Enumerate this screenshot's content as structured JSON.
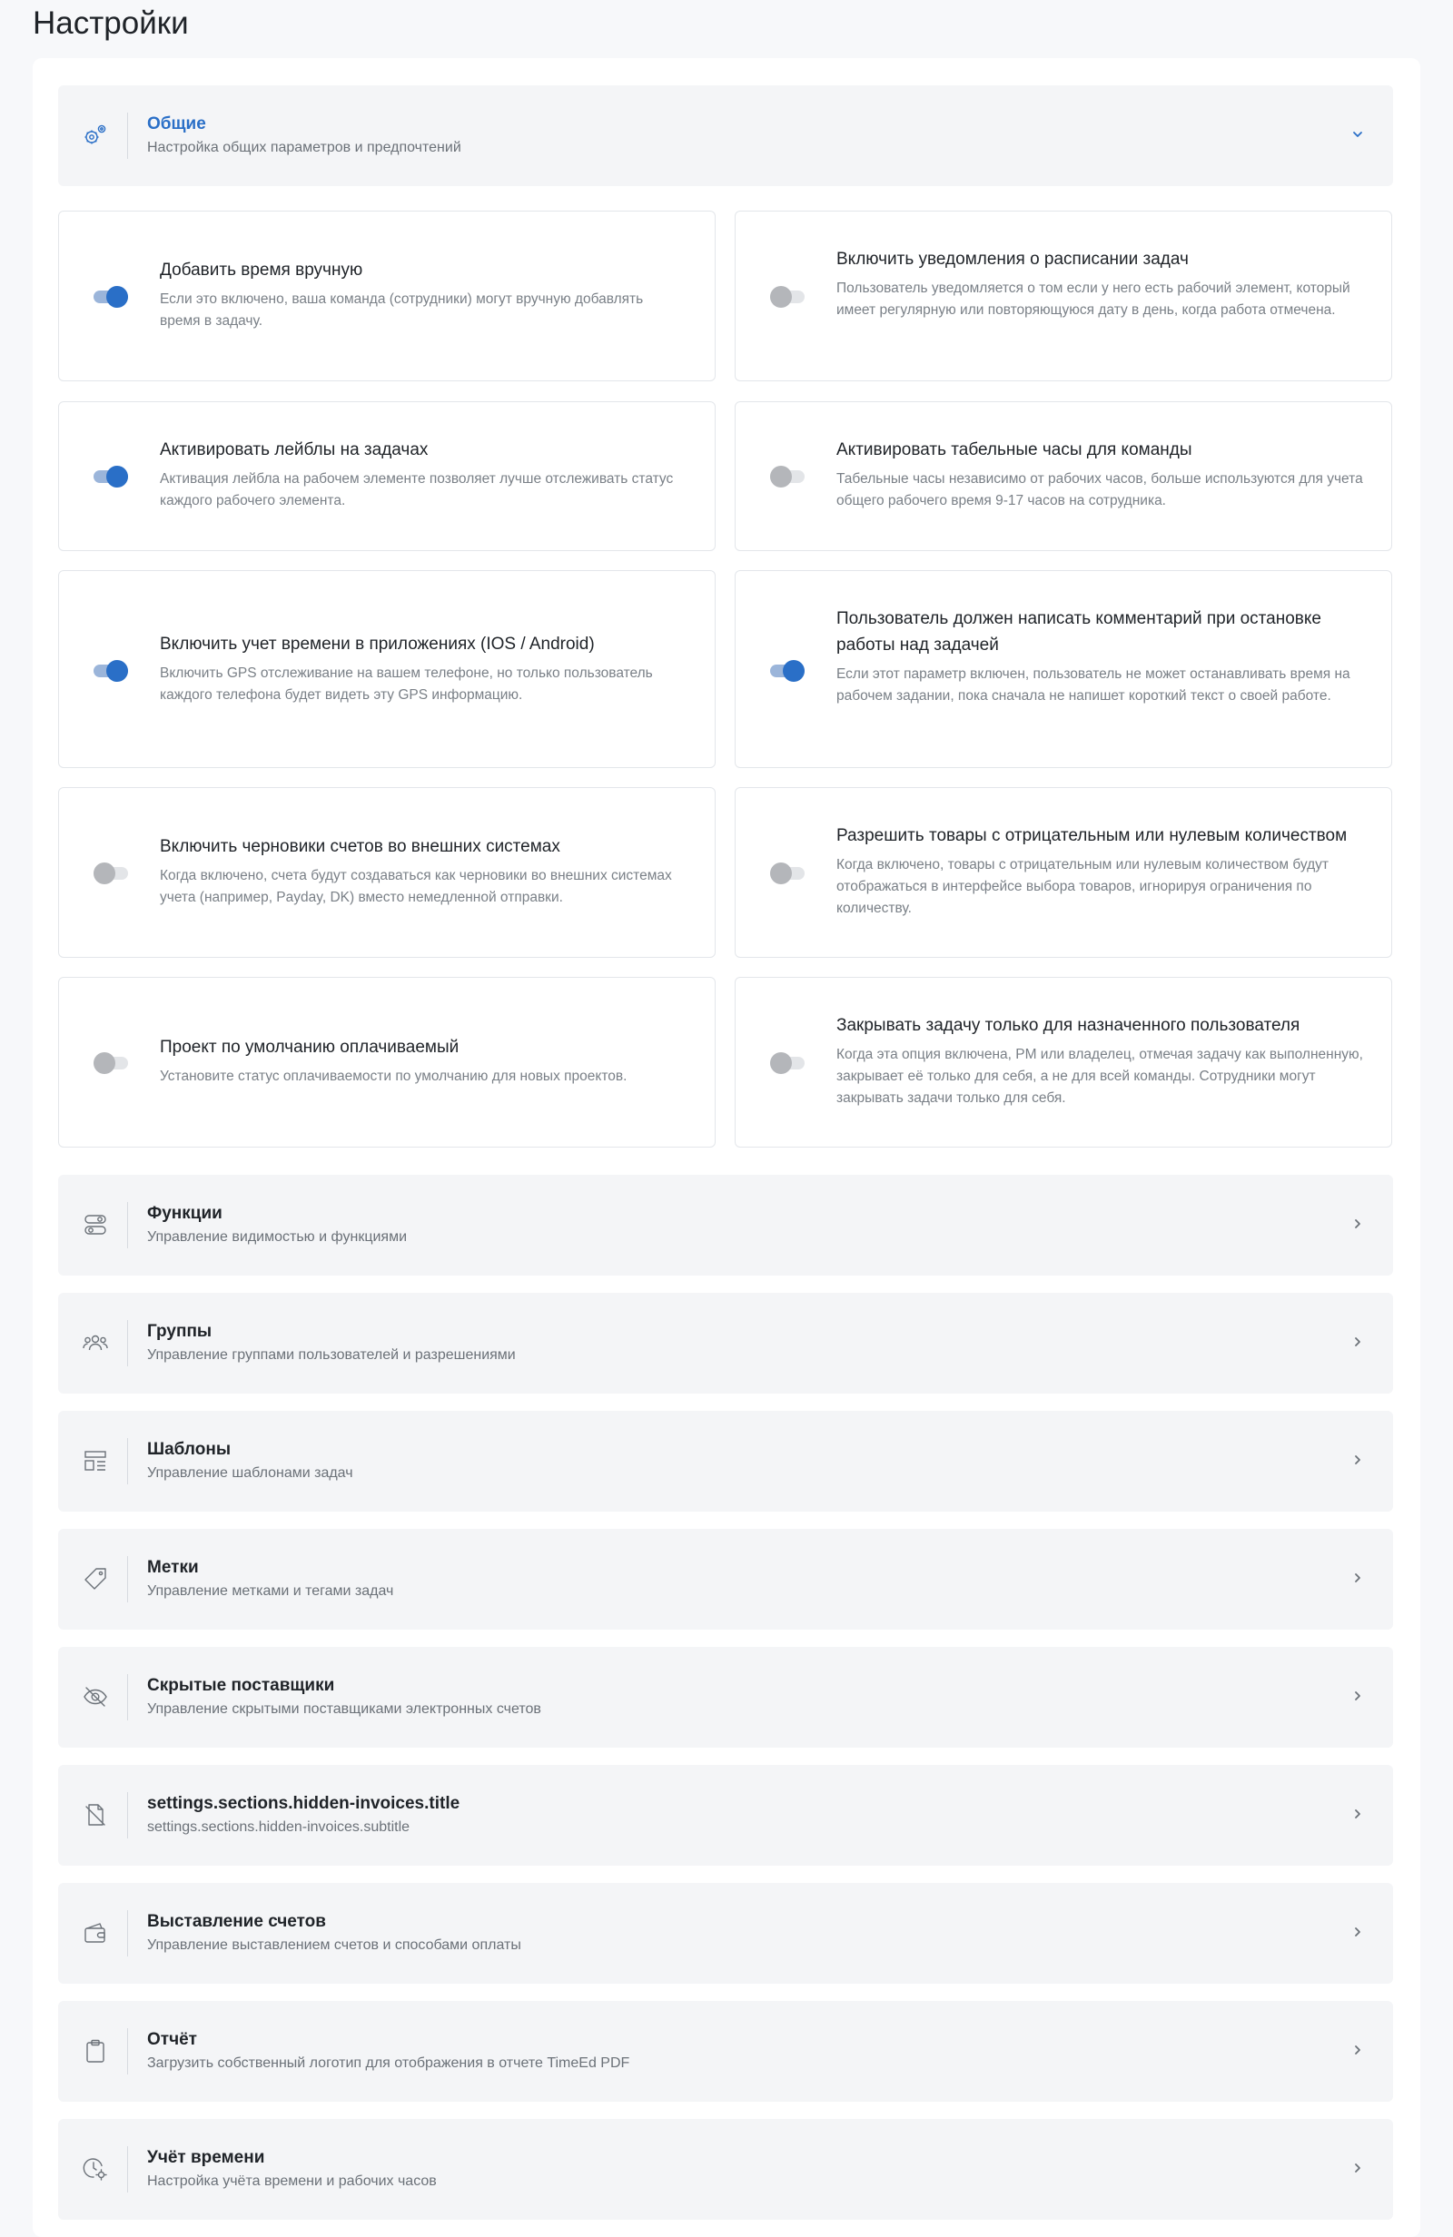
{
  "page": {
    "title": "Настройки"
  },
  "general": {
    "title": "Общие",
    "subtitle": "Настройка общих параметров и предпочтений",
    "icon": "gears-icon",
    "expanded": true
  },
  "settings": [
    {
      "title": "Добавить время вручную",
      "description": "Если это включено, ваша команда (сотрудники) могут вручную добавлять время в задачу.",
      "enabled": true
    },
    {
      "title": "Включить уведомления о расписании задач",
      "description": "Пользователь уведомляется о том если у него есть рабочий элемент, который имеет регулярную или повторяющуюся дату в день, когда работа отмечена.",
      "enabled": false
    },
    {
      "title": "Активировать лейблы на задачах",
      "description": "Активация лейбла на рабочем элементе позволяет лучше отслеживать статус каждого рабочего элемента.",
      "enabled": true
    },
    {
      "title": "Активировать табельные часы для команды",
      "description": "Табельные часы независимо от рабочих часов, больше используются для учета общего рабочего время 9-17 часов на сотрудника.",
      "enabled": false
    },
    {
      "title": "Включить учет времени в приложениях (IOS / Android)",
      "description": "Включить GPS отслеживание на вашем телефоне, но только пользователь каждого телефона будет видеть эту GPS информацию.",
      "enabled": true
    },
    {
      "title": "Пользователь должен написать комментарий при остановке работы над задачей",
      "description": "Если этот параметр включен, пользователь не может останавливать время на рабочем задании, пока сначала не напишет короткий текст о своей работе.",
      "enabled": true
    },
    {
      "title": "Включить черновики счетов во внешних системах",
      "description": "Когда включено, счета будут создаваться как черновики во внешних системах учета (например, Payday, DK) вместо немедленной отправки.",
      "enabled": false
    },
    {
      "title": "Разрешить товары с отрицательным или нулевым количеством",
      "description": "Когда включено, товары с отрицательным или нулевым количеством будут отображаться в интерфейсе выбора товаров, игнорируя ограничения по количеству.",
      "enabled": false
    },
    {
      "title": "Проект по умолчанию оплачиваемый",
      "description": "Установите статус оплачиваемости по умолчанию для новых проектов.",
      "enabled": false
    },
    {
      "title": "Закрывать задачу только для назначенного пользователя",
      "description": "Когда эта опция включена, PM или владелец, отмечая задачу как выполненную, закрывает её только для себя, а не для всей команды. Сотрудники могут закрывать задачи только для себя.",
      "enabled": false
    }
  ],
  "sections": [
    {
      "title": "Функции",
      "subtitle": "Управление видимостью и функциями",
      "icon": "toggles-icon"
    },
    {
      "title": "Группы",
      "subtitle": "Управление группами пользователей и разрешениями",
      "icon": "users-icon"
    },
    {
      "title": "Шаблоны",
      "subtitle": "Управление шаблонами задач",
      "icon": "template-icon"
    },
    {
      "title": "Метки",
      "subtitle": "Управление метками и тегами задач",
      "icon": "tag-icon"
    },
    {
      "title": "Скрытые поставщики",
      "subtitle": "Управление скрытыми поставщиками электронных счетов",
      "icon": "eye-off-icon"
    },
    {
      "title": "settings.sections.hidden-invoices.title",
      "subtitle": "settings.sections.hidden-invoices.subtitle",
      "icon": "document-off-icon"
    },
    {
      "title": "Выставление счетов",
      "subtitle": "Управление выставлением счетов и способами оплаты",
      "icon": "wallet-icon"
    },
    {
      "title": "Отчёт",
      "subtitle": "Загрузить собственный логотип для отображения в отчете TimeEd PDF",
      "icon": "clipboard-icon"
    },
    {
      "title": "Учёт времени",
      "subtitle": "Настройка учёта времени и рабочих часов",
      "icon": "clock-settings-icon"
    }
  ],
  "colors": {
    "accent": "#2a6fc7",
    "background": "#f7f8fa",
    "section_bg": "#f4f5f7"
  }
}
